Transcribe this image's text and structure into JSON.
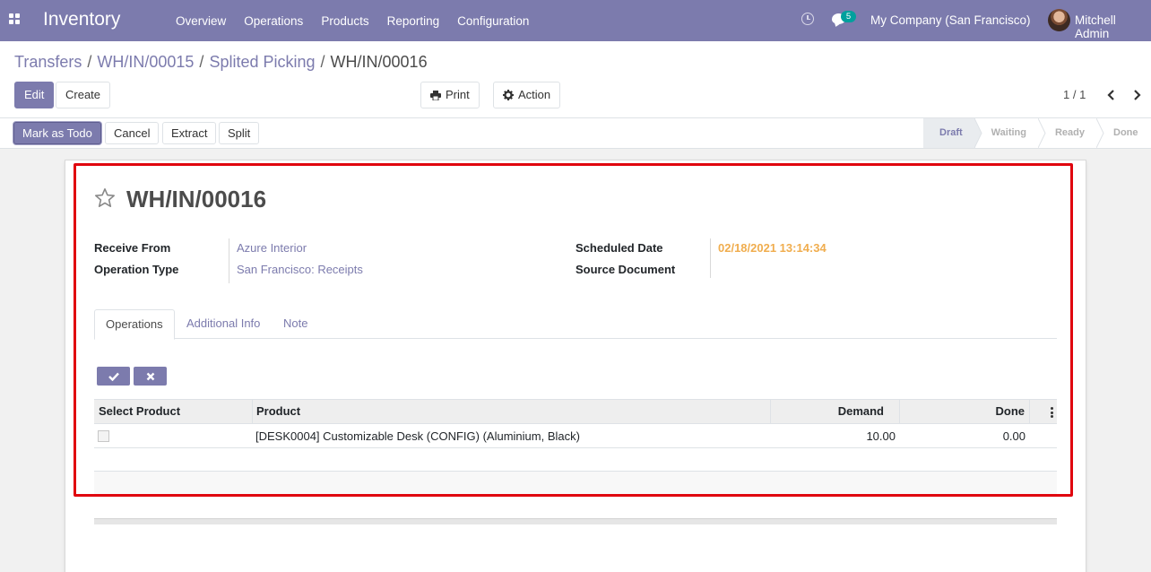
{
  "navbar": {
    "app_name": "Inventory",
    "menu": [
      "Overview",
      "Operations",
      "Products",
      "Reporting",
      "Configuration"
    ],
    "messages_count": "5",
    "company": "My Company (San Francisco)",
    "user": "Mitchell Admin",
    "icons": [
      "apps-grid-icon",
      "clock-icon",
      "chat-icon",
      "avatar"
    ]
  },
  "breadcrumb": [
    "Transfers",
    "WH/IN/00015",
    "Splited Picking",
    "WH/IN/00016"
  ],
  "control": {
    "edit": "Edit",
    "create": "Create",
    "print": "Print",
    "action": "Action",
    "pager": "1 / 1"
  },
  "statusbar": {
    "buttons": [
      "Mark as Todo",
      "Cancel",
      "Extract",
      "Split"
    ],
    "stages": [
      "Draft",
      "Waiting",
      "Ready",
      "Done"
    ],
    "current_stage": "Draft"
  },
  "form": {
    "reference": "WH/IN/00016",
    "fields": {
      "receive_from_label": "Receive From",
      "receive_from": "Azure Interior",
      "operation_type_label": "Operation Type",
      "operation_type": "San Francisco: Receipts",
      "scheduled_date_label": "Scheduled Date",
      "scheduled_date": "02/18/2021 13:14:34",
      "source_document_label": "Source Document",
      "source_document": ""
    },
    "tabs": [
      "Operations",
      "Additional Info",
      "Note"
    ],
    "active_tab": "Operations"
  },
  "table": {
    "columns": [
      "Select Product",
      "Product",
      "Demand",
      "Done"
    ],
    "rows": [
      {
        "selected": false,
        "product": "[DESK0004] Customizable Desk (CONFIG) (Aluminium, Black)",
        "demand": "10.00",
        "done": "0.00"
      }
    ]
  },
  "colors": {
    "brand": "#7c7bad",
    "date": "#f0ad4e",
    "highlight": "#e0040e",
    "badge": "#00a09d"
  }
}
